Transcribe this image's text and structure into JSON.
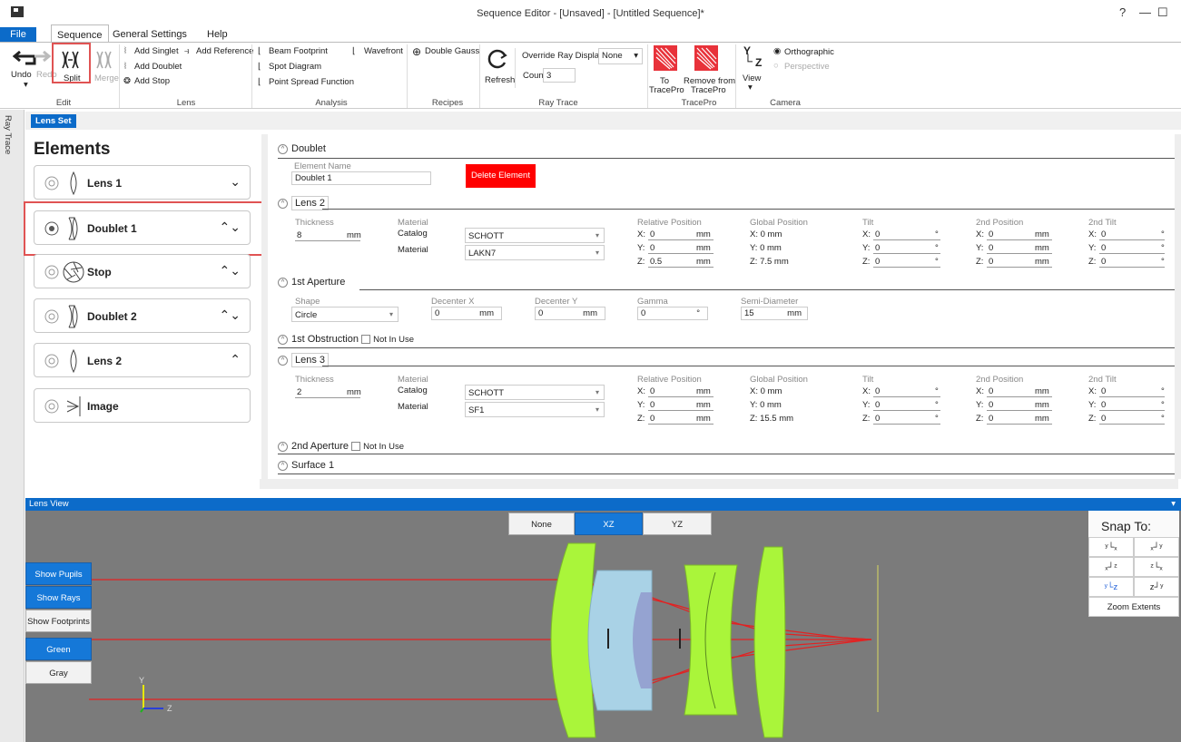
{
  "window": {
    "title": "Sequence Editor - [Unsaved] - [Untitled Sequence]*",
    "help": "?",
    "minimize": "—",
    "maximize": "☐"
  },
  "tabs": {
    "file": "File",
    "sequence": "Sequence",
    "general_settings": "General Settings",
    "help": "Help"
  },
  "ribbon": {
    "edit": {
      "undo": "Undo",
      "redo": "Redo",
      "split": "Split",
      "merge": "Merge",
      "label": "Edit"
    },
    "lens": {
      "add_singlet": "Add Singlet",
      "add_reference": "Add Reference",
      "add_doublet": "Add Doublet",
      "add_stop": "Add Stop",
      "label": "Lens"
    },
    "analysis": {
      "beam_footprint": "Beam Footprint",
      "wavefront": "Wavefront",
      "spot_diagram": "Spot Diagram",
      "psf": "Point Spread Function",
      "label": "Analysis"
    },
    "recipes": {
      "double_gauss": "Double Gauss",
      "label": "Recipes"
    },
    "raytrace": {
      "refresh": "Refresh",
      "override": "Override Ray Display",
      "override_value": "None",
      "count_label": "Count",
      "count_value": "3",
      "label": "Ray Trace"
    },
    "tracepro": {
      "to_line1": "To",
      "to_line2": "TracePro",
      "remove_line1": "Remove from",
      "remove_line2": "TracePro",
      "label": "TracePro"
    },
    "camera": {
      "view": "View",
      "orthographic": "Orthographic",
      "perspective": "Perspective",
      "label": "Camera",
      "axis_y": "Y",
      "axis_z": "Z"
    }
  },
  "sidebar": {
    "ray_trace": "Ray Trace"
  },
  "lens_set_tab": "Lens Set",
  "elements": {
    "title": "Elements",
    "items": [
      {
        "label": "Lens 1",
        "chev": "⌄"
      },
      {
        "label": "Doublet 1",
        "chev": "⌃⌄"
      },
      {
        "label": "Stop",
        "chev": "⌃⌄"
      },
      {
        "label": "Doublet 2",
        "chev": "⌃⌄"
      },
      {
        "label": "Lens 2",
        "chev": "⌃"
      },
      {
        "label": "Image",
        "chev": ""
      }
    ]
  },
  "props": {
    "doublet": "Doublet",
    "element_name_label": "Element Name",
    "element_name": "Doublet 1",
    "delete": "Delete Element",
    "lens2": {
      "title": "Lens 2",
      "thickness": "8",
      "catalog": "SCHOTT",
      "material": "LAKN7",
      "rel": [
        "0",
        "0",
        "0.5"
      ],
      "glob": [
        "X: 0 mm",
        "Y: 0 mm",
        "Z: 7.5 mm"
      ],
      "tilt": [
        "0",
        "0",
        "0"
      ],
      "pos2": [
        "0",
        "0",
        "0"
      ],
      "tilt2": [
        "0",
        "0",
        "0"
      ]
    },
    "lens3": {
      "title": "Lens 3",
      "thickness": "2",
      "catalog": "SCHOTT",
      "material": "SF1",
      "rel": [
        "0",
        "0",
        "0"
      ],
      "glob": [
        "X: 0 mm",
        "Y: 0 mm",
        "Z: 15.5 mm"
      ],
      "tilt": [
        "0",
        "0",
        "0"
      ],
      "pos2": [
        "0",
        "0",
        "0"
      ],
      "tilt2": [
        "0",
        "0",
        "0"
      ]
    },
    "labels": {
      "thickness": "Thickness",
      "material_hdr": "Material",
      "catalog": "Catalog",
      "material": "Material",
      "rel": "Relative Position",
      "glob": "Global Position",
      "tilt": "Tilt",
      "pos2": "2nd Position",
      "tilt2": "2nd Tilt",
      "mm": "mm",
      "deg": "°",
      "x": "X:",
      "y": "Y:",
      "z": "Z:"
    },
    "aperture1": {
      "title": "1st Aperture",
      "shape_label": "Shape",
      "shape": "Circle",
      "dx_label": "Decenter X",
      "dx": "0",
      "dy_label": "Decenter Y",
      "dy": "0",
      "gamma_label": "Gamma",
      "gamma": "0",
      "sd_label": "Semi-Diameter",
      "sd": "15"
    },
    "obstruction1": {
      "title": "1st Obstruction",
      "not_in_use": "Not In Use"
    },
    "aperture2": {
      "title": "2nd Aperture",
      "not_in_use": "Not In Use"
    },
    "surface1": "Surface 1"
  },
  "lens_view": {
    "title": "Lens View",
    "none": "None",
    "xz": "XZ",
    "yz": "YZ",
    "show_pupils": "Show Pupils",
    "show_rays": "Show Rays",
    "show_footprints": "Show Footprints",
    "green": "Green",
    "gray": "Gray",
    "snap_to": "Snap To:",
    "zoom_extents": "Zoom Extents",
    "axis_y": "Y",
    "axis_z": "Z"
  },
  "colors": {
    "accent": "#0c6bc9",
    "lens_green": "#aaf53a",
    "lens_blue": "#a9d2e6",
    "ray": "#e22222",
    "viewport": "#7b7b7b"
  }
}
